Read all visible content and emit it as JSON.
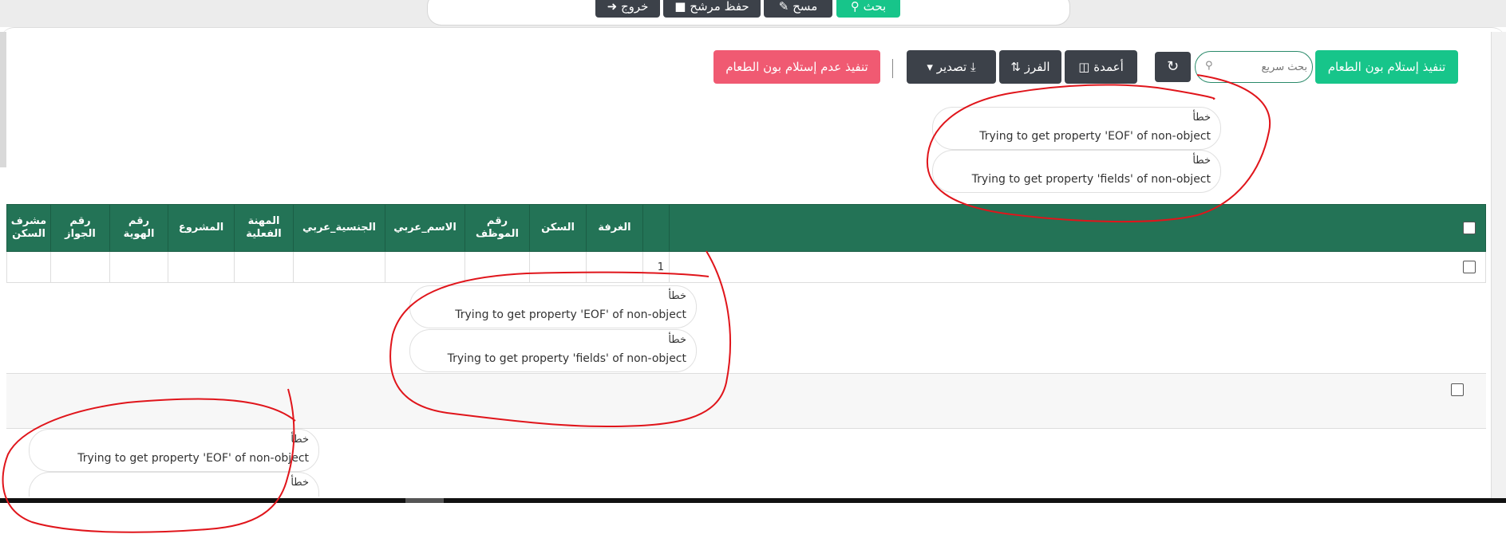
{
  "top_toolbar": {
    "search_label": "بحث",
    "clear_label": "مسح",
    "save_filter_label": "حفظ مرشح",
    "exit_label": "خروج"
  },
  "toolbar": {
    "receive_meal_label": "تنفيذ إستلام بون الطعام",
    "not_receive_meal_label": "تنفيذ عدم إستلام بون الطعام",
    "search_placeholder": "بحث سريع",
    "columns_label": "أعمدة",
    "sort_label": "الفرز",
    "export_label": "تصدير"
  },
  "errors": {
    "title": "خطأ",
    "eof_message": "Trying to get property 'EOF' of non-object",
    "fields_message": "Trying to get property 'fields' of non-object"
  },
  "table": {
    "headers": [
      "الغرفة",
      "السكن",
      "رقم الموظف",
      "الاسم_عربي",
      "الجنسية_عربي",
      "المهنة الفعلية",
      "المشروع",
      "رقم الهوية",
      "رقم الجواز",
      "مشرف السكن"
    ],
    "rows": [
      {
        "index": "1",
        "cells": [
          "",
          "",
          "",
          "",
          "",
          "",
          "",
          "",
          "",
          ""
        ]
      }
    ]
  },
  "colors": {
    "header_green": "#237356",
    "accent_green": "#17c58a",
    "danger_pink": "#f05a72",
    "dark_button": "#3c4149",
    "annotation_red": "#e0151b"
  },
  "icons": [
    "search-icon",
    "eraser-icon",
    "save-icon",
    "exit-icon",
    "refresh-icon",
    "columns-icon",
    "sort-icon",
    "download-icon",
    "caret-down-icon"
  ]
}
